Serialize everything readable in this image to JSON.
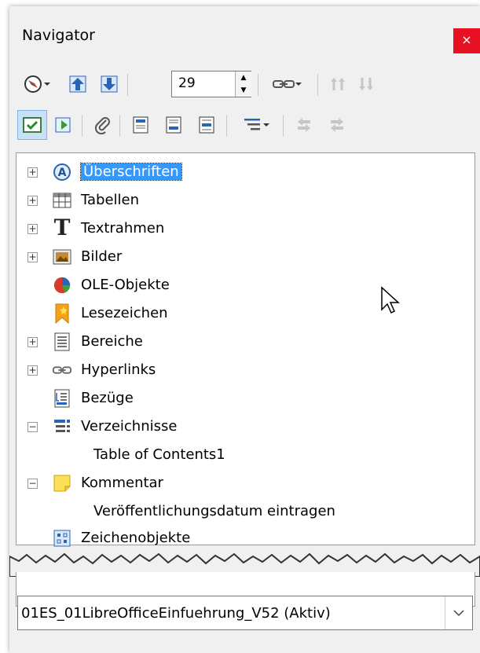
{
  "window": {
    "title": "Navigator",
    "close_label": "×"
  },
  "toolbar1": {
    "spin_value": "29"
  },
  "tree": {
    "items": [
      {
        "label": "Überschriften",
        "expander": "+"
      },
      {
        "label": "Tabellen",
        "expander": "+"
      },
      {
        "label": "Textrahmen",
        "expander": "+"
      },
      {
        "label": "Bilder",
        "expander": "+"
      },
      {
        "label": "OLE-Objekte",
        "expander": ""
      },
      {
        "label": "Lesezeichen",
        "expander": ""
      },
      {
        "label": "Bereiche",
        "expander": "+"
      },
      {
        "label": "Hyperlinks",
        "expander": "+"
      },
      {
        "label": "Bezüge",
        "expander": ""
      },
      {
        "label": "Verzeichnisse",
        "expander": "−"
      },
      {
        "label": "Table of Contents1",
        "expander": ""
      },
      {
        "label": "Kommentar",
        "expander": "−"
      },
      {
        "label": "Veröffentlichungsdatum eintragen",
        "expander": ""
      },
      {
        "label": "Zeichenobjekte",
        "expander": ""
      }
    ]
  },
  "document_select": {
    "value": "01ES_01LibreOfficeEinfuehrung_V52 (Aktiv)"
  },
  "colors": {
    "selection": "#3399ff",
    "close": "#e81123",
    "accent": "#1e6fd0"
  }
}
